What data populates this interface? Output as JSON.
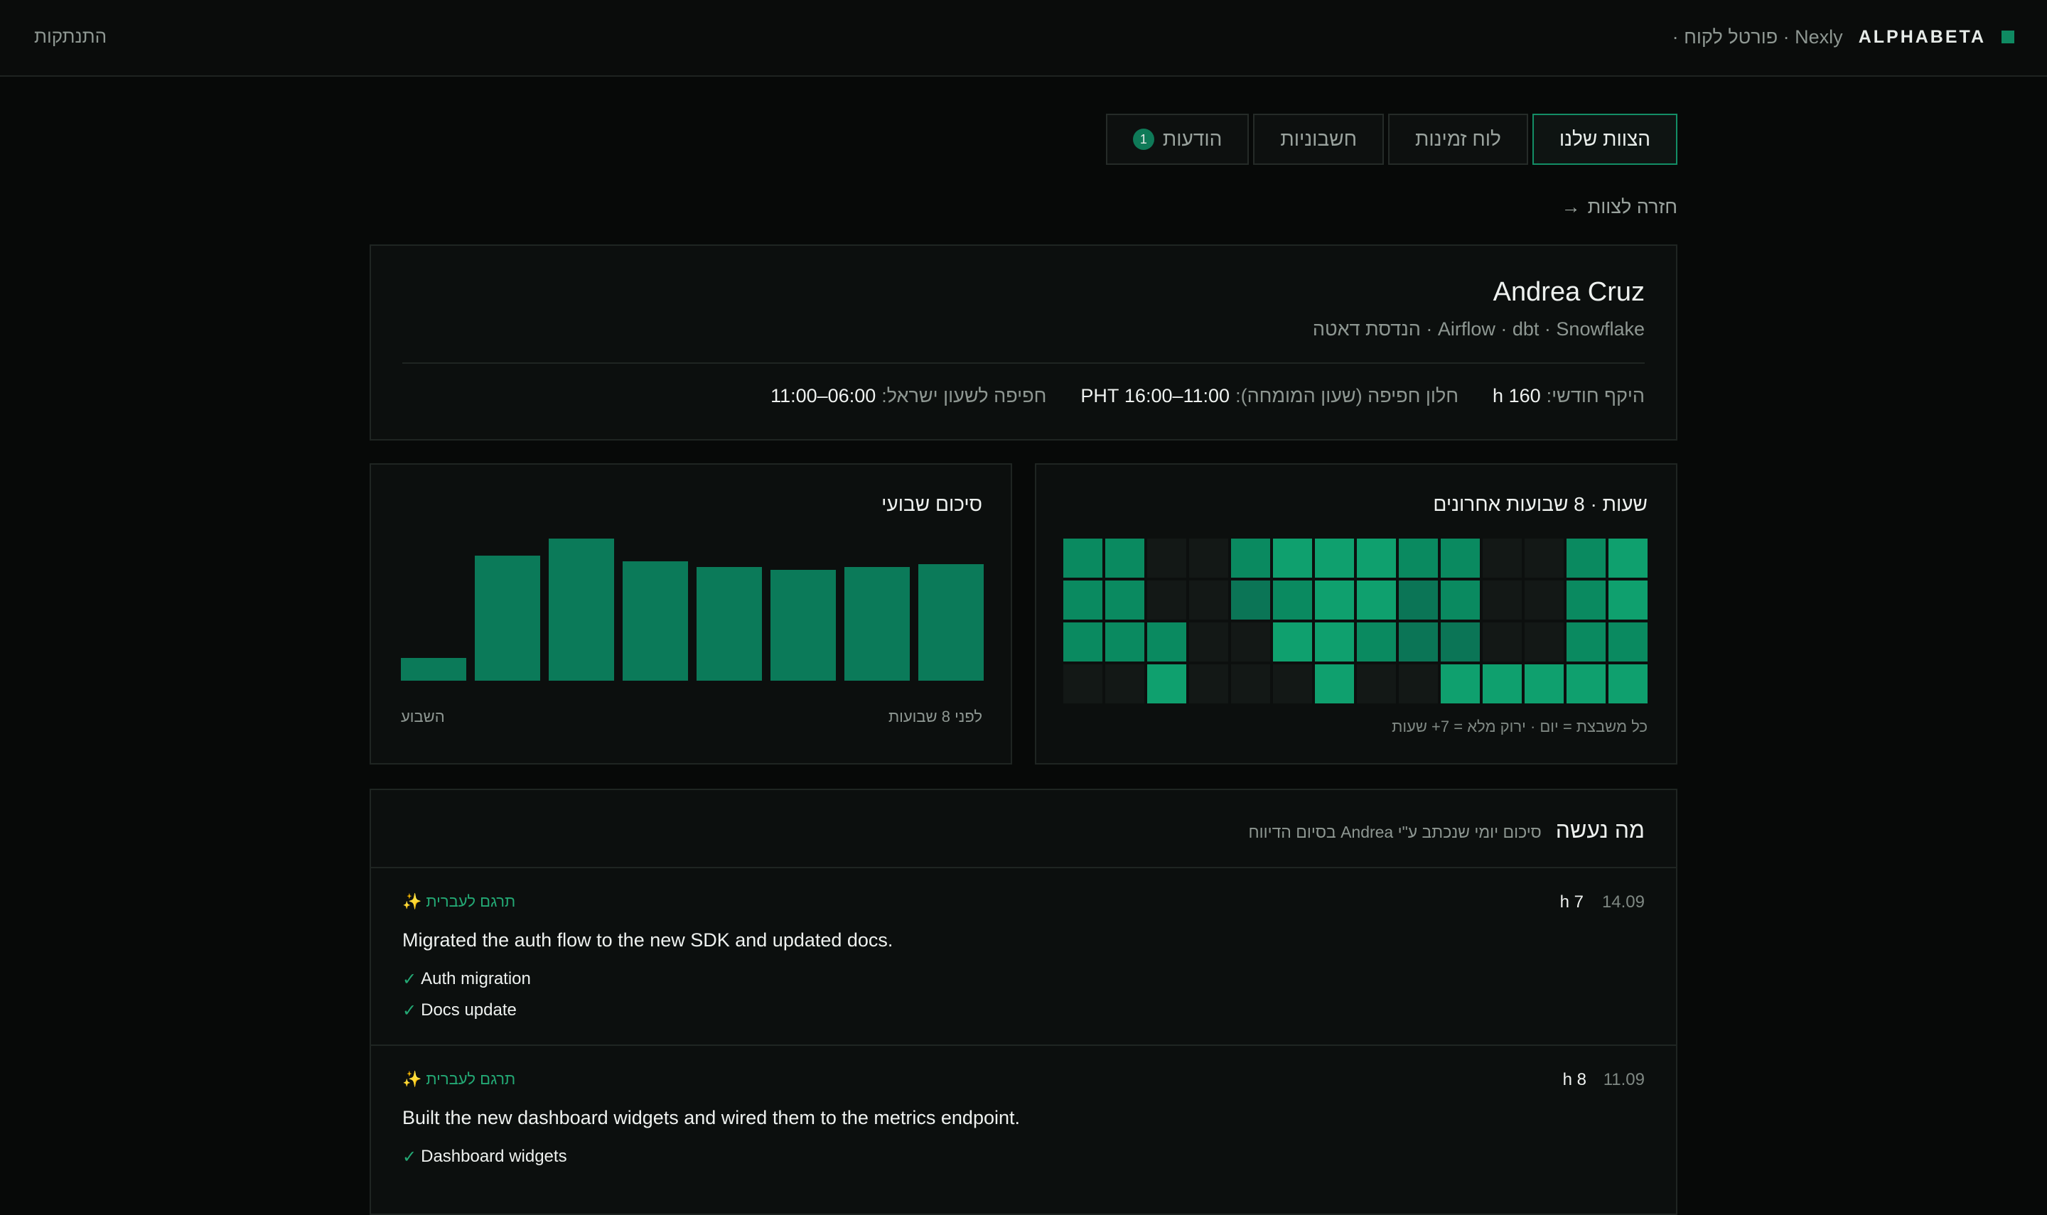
{
  "header": {
    "brand": "ALPHABETA",
    "subtitle": "Nexly · פורטל לקוח ·",
    "logout": "התנתקות"
  },
  "tabs": [
    {
      "label": "הצוות שלנו",
      "active": true
    },
    {
      "label": "לוח זמינות"
    },
    {
      "label": "חשבוניות"
    },
    {
      "label": "הודעות",
      "badge": "1"
    }
  ],
  "back_link": {
    "arrow": "→",
    "label": "חזרה לצוות"
  },
  "profile": {
    "name": "Andrea Cruz",
    "skills": "Airflow · dbt · Snowflake · הנדסת דאטה",
    "meta": [
      {
        "label": "היקף חודשי:",
        "value": "160 h"
      },
      {
        "label": "חלון חפיפה (שעון המומחה):",
        "value": "11:00–16:00 PHT"
      },
      {
        "label": "חפיפה לשעון ישראל:",
        "value": "06:00–11:00"
      }
    ]
  },
  "heatmap": {
    "title": "שעות · 8 שבועות אחרונים",
    "note": "כל משבצת = יום · ירוק מלא = 7+ שעות",
    "rows": [
      [
        3,
        2,
        0,
        0,
        2,
        2,
        3,
        3,
        3,
        2,
        0,
        0,
        2,
        2
      ],
      [
        3,
        2,
        0,
        0,
        2,
        1,
        3,
        3,
        2,
        1,
        0,
        0,
        2,
        2
      ],
      [
        2,
        2,
        0,
        0,
        1,
        1,
        2,
        3,
        3,
        0,
        0,
        2,
        2,
        2
      ],
      [
        3,
        3,
        3,
        3,
        3,
        0,
        0,
        3,
        0,
        0,
        0,
        3,
        0,
        0
      ]
    ],
    "colors": {
      "empty": "#131816",
      "low": "#0b7556",
      "mid": "#0a8a60",
      "full": "#0fa06e"
    }
  },
  "weekly": {
    "title": "סיכום שבועי",
    "label_start": "לפני 8 שבועות",
    "label_end": "השבוע"
  },
  "chart_data": {
    "type": "bar",
    "categories": [
      "לפני 8 שבועות",
      "",
      "",
      "",
      "",
      "",
      "",
      "השבוע"
    ],
    "values": [
      41,
      40,
      39,
      40,
      42,
      50,
      44,
      8
    ],
    "ylim": [
      0,
      50
    ],
    "color": "#0b7a59"
  },
  "done": {
    "title": "מה נעשה",
    "subtitle": "סיכום יומי שנכתב ע\"י Andrea בסיום הדיווח",
    "entries": [
      {
        "date": "14.09",
        "hours": "7 h",
        "translate": "תרגם לעברית",
        "text": "Migrated the auth flow to the new SDK and updated docs.",
        "items": [
          "Auth migration",
          "Docs update"
        ]
      },
      {
        "date": "11.09",
        "hours": "8 h",
        "translate": "תרגם לעברית",
        "text": "Built the new dashboard widgets and wired them to the metrics endpoint.",
        "items": [
          "Dashboard widgets"
        ]
      }
    ]
  }
}
